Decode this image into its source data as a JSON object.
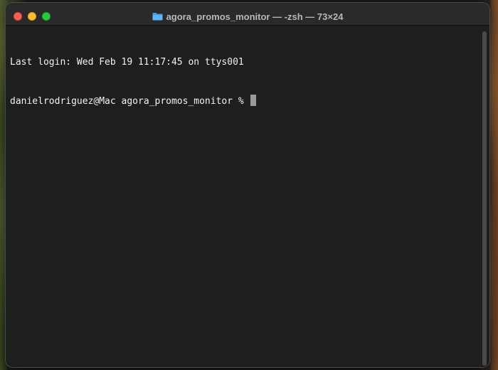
{
  "window": {
    "title": "agora_promos_monitor — -zsh — 73×24",
    "title_icon": "folder-icon",
    "traffic_lights": {
      "close_color": "#ff5f57",
      "minimize_color": "#febc2e",
      "zoom_color": "#28c840"
    }
  },
  "terminal": {
    "last_login": "Last login: Wed Feb 19 11:17:45 on ttys001",
    "prompt": "danielrodriguez@Mac agora_promos_monitor % ",
    "input": "",
    "background_color": "#1e1e1e",
    "text_color": "#f2f2f2"
  }
}
